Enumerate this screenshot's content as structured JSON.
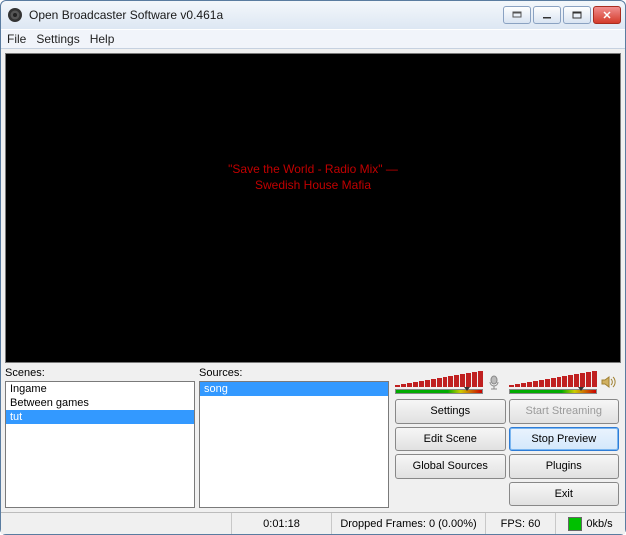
{
  "window": {
    "title": "Open Broadcaster Software v0.461a"
  },
  "menu": {
    "file": "File",
    "settings": "Settings",
    "help": "Help"
  },
  "preview": {
    "nowplaying_line1": "\"Save the World - Radio Mix\" —",
    "nowplaying_line2": "Swedish House Mafia"
  },
  "panels": {
    "scenes_label": "Scenes:",
    "sources_label": "Sources:"
  },
  "scenes": [
    {
      "name": "Ingame",
      "selected": false
    },
    {
      "name": "Between games",
      "selected": false
    },
    {
      "name": "tut",
      "selected": true
    }
  ],
  "sources": [
    {
      "name": "song",
      "selected": true
    }
  ],
  "buttons": {
    "settings": "Settings",
    "start_streaming": "Start Streaming",
    "edit_scene": "Edit Scene",
    "stop_preview": "Stop Preview",
    "global_sources": "Global Sources",
    "plugins": "Plugins",
    "exit": "Exit"
  },
  "status": {
    "time": "0:01:18",
    "dropped": "Dropped Frames: 0 (0.00%)",
    "fps": "FPS: 60",
    "bitrate": "0kb/s"
  },
  "meters": {
    "mic_active": false,
    "speaker_active": true
  }
}
